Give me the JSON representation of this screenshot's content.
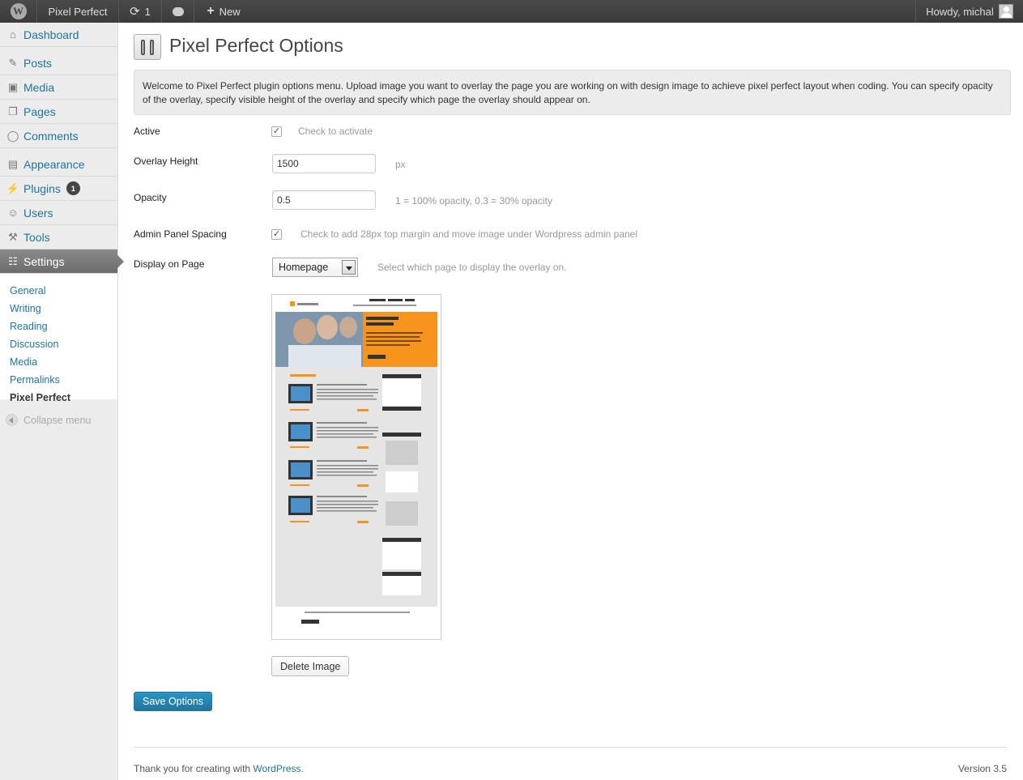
{
  "adminbar": {
    "site_name": "Pixel Perfect",
    "updates_count": "1",
    "new_label": "New",
    "greeting": "Howdy, michal"
  },
  "sidebar": {
    "items": [
      {
        "label": "Dashboard",
        "icon": "dashboard-icon"
      },
      {
        "label": "Posts",
        "icon": "pushpin-icon"
      },
      {
        "label": "Media",
        "icon": "media-icon"
      },
      {
        "label": "Pages",
        "icon": "pages-icon"
      },
      {
        "label": "Comments",
        "icon": "comment-icon"
      },
      {
        "label": "Appearance",
        "icon": "appearance-icon"
      },
      {
        "label": "Plugins",
        "icon": "plugin-icon",
        "badge": "1"
      },
      {
        "label": "Users",
        "icon": "users-icon"
      },
      {
        "label": "Tools",
        "icon": "tools-icon"
      },
      {
        "label": "Settings",
        "icon": "settings-icon"
      }
    ],
    "submenu": [
      "General",
      "Writing",
      "Reading",
      "Discussion",
      "Media",
      "Permalinks",
      "Pixel Perfect"
    ],
    "collapse_label": "Collapse menu"
  },
  "page": {
    "title": "Pixel Perfect Options",
    "intro": "Welcome to Pixel Perfect plugin options menu. Upload image you want to overlay the page you are working on with design image to achieve pixel perfect layout when coding. You can specify opacity of the overlay, specify visible height of the overlay and specify which page the overlay should appear on."
  },
  "form": {
    "active": {
      "label": "Active",
      "checked": true,
      "hint": "Check to activate"
    },
    "overlay_height": {
      "label": "Overlay Height",
      "value": "1500",
      "hint": "px"
    },
    "opacity": {
      "label": "Opacity",
      "value": "0.5",
      "hint": "1 = 100% opacity, 0.3 = 30% opacity"
    },
    "admin_spacing": {
      "label": "Admin Panel Spacing",
      "checked": true,
      "hint": "Check to add 28px top margin and move image under Wordpress admin panel"
    },
    "display_page": {
      "label": "Display on Page",
      "value": "Homepage",
      "hint": "Select which page to display the overlay on."
    },
    "delete_label": "Delete Image",
    "save_label": "Save Options"
  },
  "footer": {
    "thanks": "Thank you for creating with ",
    "link": "WordPress",
    "dot": ".",
    "version": "Version 3.5"
  },
  "colors": {
    "accent": "#21759b",
    "preview_orange": "#f7941d"
  }
}
